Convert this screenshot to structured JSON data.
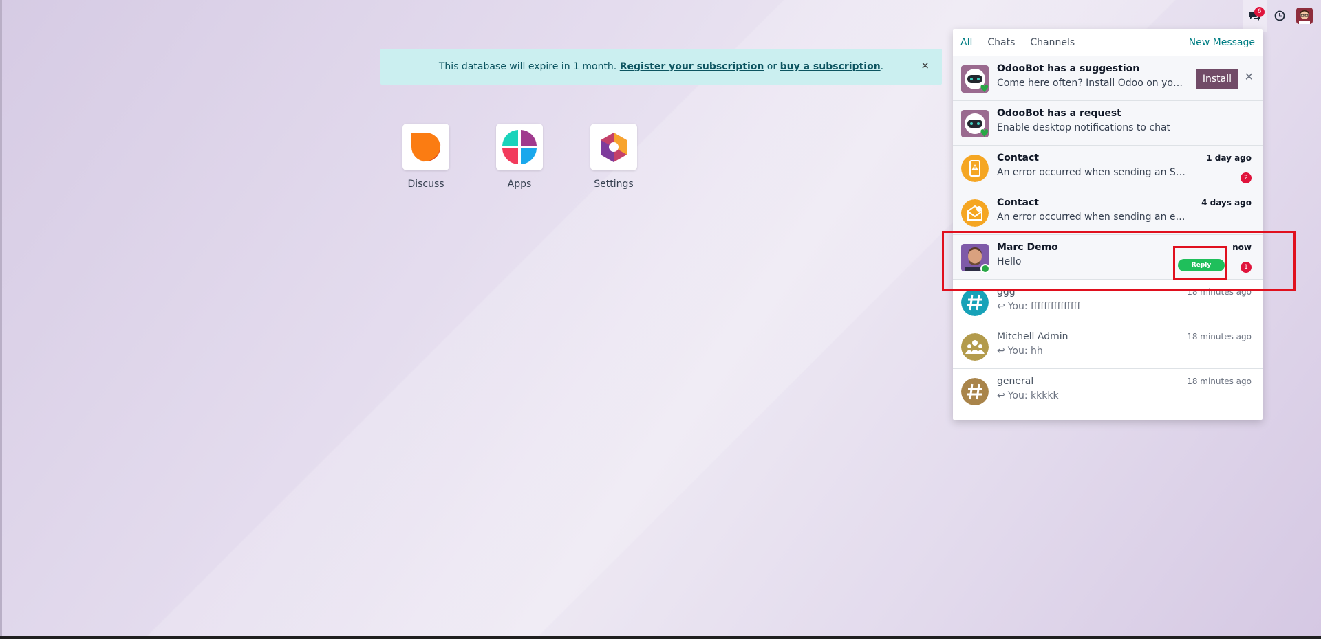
{
  "systray": {
    "messages_badge": "6"
  },
  "banner": {
    "text_before": "This database will expire in 1 month. ",
    "link1": "Register your subscription",
    "middle": " or ",
    "link2": "buy a subscription",
    "after": ".",
    "close": "×"
  },
  "apps": [
    {
      "label": "Discuss"
    },
    {
      "label": "Apps"
    },
    {
      "label": "Settings"
    }
  ],
  "panel": {
    "tabs": [
      "All",
      "Chats",
      "Channels"
    ],
    "new_message": "New Message",
    "items": [
      {
        "title": "OdooBot has a suggestion",
        "body": "Come here often? Install Odoo on your de...",
        "action": "Install",
        "dismiss": "✕"
      },
      {
        "title": "OdooBot has a request",
        "body": "Enable desktop notifications to chat"
      },
      {
        "title": "Contact",
        "body": "An error occurred when sending an SMS",
        "time": "1 day ago",
        "count": "2"
      },
      {
        "title": "Contact",
        "body": "An error occurred when sending an email",
        "time": "4 days ago"
      },
      {
        "title": "Marc Demo",
        "body": "Hello",
        "time": "now",
        "count": "1",
        "action": "Reply"
      },
      {
        "title": "ggg",
        "body": "You: fffffffffffffff",
        "time": "18 minutes ago"
      },
      {
        "title": "Mitchell Admin",
        "body": "You: hh",
        "time": "18 minutes ago"
      },
      {
        "title": "general",
        "body": "You: kkkkk",
        "time": "18 minutes ago"
      }
    ]
  },
  "colors": {
    "accent": "#017e84",
    "brand": "#714b67",
    "badge": "#e0143c",
    "highlight": "#e0101e",
    "reply": "#1fbf5b"
  }
}
